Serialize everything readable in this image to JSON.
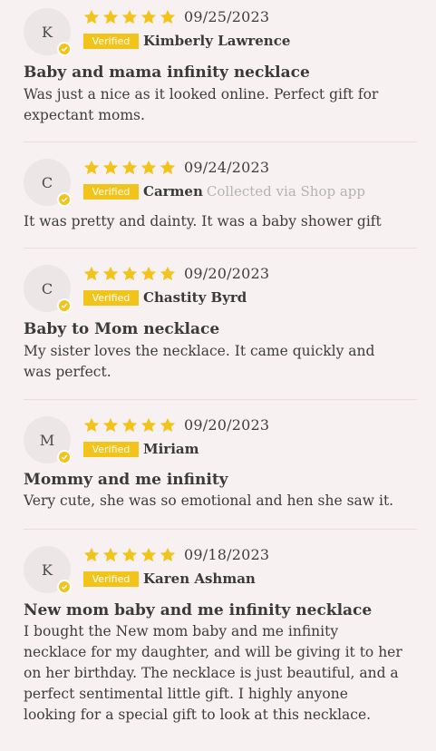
{
  "colors": {
    "background": "#f8f1f1",
    "star": "#f2c318",
    "badge": "#f2c318",
    "avatar": "#ece6e6"
  },
  "reviews": [
    {
      "initial": "K",
      "rating": 5,
      "date": "09/25/2023",
      "badge": "Verified",
      "author": "Kimberly Lawrence",
      "source": "",
      "title": "Baby and mama infinity necklace",
      "body": "Was just a nice as it looked online. Perfect gift for expectant moms."
    },
    {
      "initial": "C",
      "rating": 5,
      "date": "09/24/2023",
      "badge": "Verified",
      "author": "Carmen",
      "source": "Collected via Shop app",
      "title": "",
      "body": "It was pretty and dainty. It was a baby shower gift"
    },
    {
      "initial": "C",
      "rating": 5,
      "date": "09/20/2023",
      "badge": "Verified",
      "author": "Chastity Byrd",
      "source": "",
      "title": "Baby to Mom necklace",
      "body": "My sister loves the necklace. It came quickly and was perfect."
    },
    {
      "initial": "M",
      "rating": 5,
      "date": "09/20/2023",
      "badge": "Verified",
      "author": "Miriam",
      "source": "",
      "title": "Mommy and me infinity",
      "body": "Very cute, she was so emotional and hen she saw it."
    },
    {
      "initial": "K",
      "rating": 5,
      "date": "09/18/2023",
      "badge": "Verified",
      "author": "Karen Ashman",
      "source": "",
      "title": "New mom baby and me infinity necklace",
      "body": "I bought the New mom baby and me infinity necklace for my daughter, and will be giving it to her on her birthday. The necklace is just beautiful, and a perfect sentimental little gift. I highly anyone looking for a special gift to look at this necklace."
    }
  ]
}
